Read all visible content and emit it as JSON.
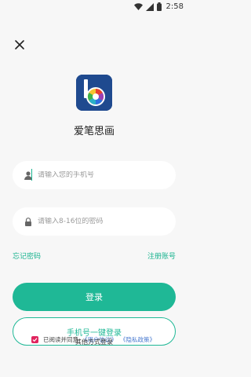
{
  "status_bar": {
    "time": "2:58",
    "icons": [
      "wifi-icon",
      "signal-icon",
      "battery-icon"
    ]
  },
  "app": {
    "name": "爱笔思画"
  },
  "form": {
    "phone_placeholder": "请输入您的手机号",
    "password_placeholder": "请输入8-16位的密码"
  },
  "links": {
    "forgot_password": "忘记密码",
    "register": "注册账号"
  },
  "buttons": {
    "login": "登录",
    "one_key_login": "手机号一键登录"
  },
  "agreement": {
    "prefix": "已阅读并同意",
    "user_agreement": "《用户协议》",
    "privacy_policy": "《隐私政策》",
    "checked": true
  },
  "other_login": "其他方式登录",
  "colors": {
    "accent": "#1fb896",
    "checkbox": "#e0245e",
    "link_blue": "#4a7bd0",
    "background": "#f7f7f7"
  }
}
